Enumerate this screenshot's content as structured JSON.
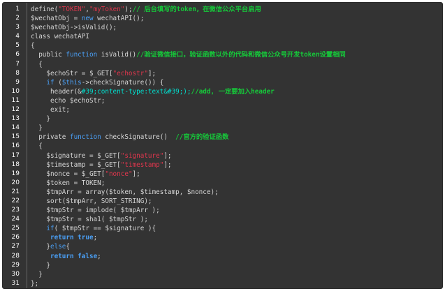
{
  "colors": {
    "background": "#333333",
    "text": "#d6d6d6",
    "keyword": "#4a9ff5",
    "string": "#e0364d",
    "comment": "#16c83a",
    "highlight": "#00e0d0",
    "line_number": "#ffffff"
  },
  "lines": [
    {
      "n": "1",
      "indent": "",
      "tokens": [
        {
          "t": "define(",
          "c": "tx"
        },
        {
          "t": "\"TOKEN\"",
          "c": "str"
        },
        {
          "t": ",",
          "c": "tx"
        },
        {
          "t": "\"myToken\"",
          "c": "str"
        },
        {
          "t": ");",
          "c": "tx"
        },
        {
          "t": "// 后台填写的token，在微信公众平台启用",
          "c": "cm"
        }
      ]
    },
    {
      "n": "2",
      "indent": "",
      "tokens": [
        {
          "t": "$wechatObj = ",
          "c": "tx"
        },
        {
          "t": "new",
          "c": "kw"
        },
        {
          "t": " wechatAPI();",
          "c": "tx"
        }
      ]
    },
    {
      "n": "3",
      "indent": "",
      "tokens": [
        {
          "t": "$wechatObj->isValid();",
          "c": "tx"
        }
      ]
    },
    {
      "n": "4",
      "indent": "",
      "tokens": [
        {
          "t": "class wechatAPI",
          "c": "tx"
        }
      ]
    },
    {
      "n": "5",
      "indent": "",
      "tokens": [
        {
          "t": "{",
          "c": "tx"
        }
      ]
    },
    {
      "n": "6",
      "indent": "  ",
      "tokens": [
        {
          "t": "public ",
          "c": "tx"
        },
        {
          "t": "function",
          "c": "kw"
        },
        {
          "t": " isValid()",
          "c": "tx"
        },
        {
          "t": "//验证微信接口，验证函数以外的代码和微信公众号开发token设置相同",
          "c": "cm"
        }
      ]
    },
    {
      "n": "7",
      "indent": "  ",
      "tokens": [
        {
          "t": "{",
          "c": "tx"
        }
      ]
    },
    {
      "n": "8",
      "indent": "    ",
      "tokens": [
        {
          "t": "$echoStr = $_GET[",
          "c": "tx"
        },
        {
          "t": "\"echostr\"",
          "c": "str"
        },
        {
          "t": "];",
          "c": "tx"
        }
      ]
    },
    {
      "n": "9",
      "indent": "    ",
      "tokens": [
        {
          "t": "if",
          "c": "kw"
        },
        {
          "t": " (",
          "c": "tx"
        },
        {
          "t": "$this",
          "c": "kw"
        },
        {
          "t": "->checkSignature()) {",
          "c": "tx"
        }
      ]
    },
    {
      "n": "10",
      "indent": "     ",
      "tokens": [
        {
          "t": "header(&",
          "c": "tx"
        },
        {
          "t": "#39;content-type:text&#39;);",
          "c": "hl"
        },
        {
          "t": "//add, 一定要加入header",
          "c": "cm"
        }
      ]
    },
    {
      "n": "11",
      "indent": "     ",
      "tokens": [
        {
          "t": "echo $echoStr;",
          "c": "tx"
        }
      ]
    },
    {
      "n": "12",
      "indent": "     ",
      "tokens": [
        {
          "t": "exit;",
          "c": "tx"
        }
      ]
    },
    {
      "n": "13",
      "indent": "    ",
      "tokens": [
        {
          "t": "}",
          "c": "tx"
        }
      ]
    },
    {
      "n": "14",
      "indent": "  ",
      "tokens": [
        {
          "t": "}",
          "c": "tx"
        }
      ]
    },
    {
      "n": "15",
      "indent": "  ",
      "tokens": [
        {
          "t": "private ",
          "c": "tx"
        },
        {
          "t": "function",
          "c": "kw"
        },
        {
          "t": " checkSignature()  ",
          "c": "tx"
        },
        {
          "t": "//官方的验证函数",
          "c": "cm"
        }
      ]
    },
    {
      "n": "16",
      "indent": "  ",
      "tokens": [
        {
          "t": "{",
          "c": "tx"
        }
      ]
    },
    {
      "n": "17",
      "indent": "    ",
      "tokens": [
        {
          "t": "$signature = $_GET[",
          "c": "tx"
        },
        {
          "t": "\"signature\"",
          "c": "str"
        },
        {
          "t": "];",
          "c": "tx"
        }
      ]
    },
    {
      "n": "18",
      "indent": "    ",
      "tokens": [
        {
          "t": "$timestamp = $_GET[",
          "c": "tx"
        },
        {
          "t": "\"timestamp\"",
          "c": "str"
        },
        {
          "t": "];",
          "c": "tx"
        }
      ]
    },
    {
      "n": "19",
      "indent": "    ",
      "tokens": [
        {
          "t": "$nonce = $_GET[",
          "c": "tx"
        },
        {
          "t": "\"nonce\"",
          "c": "str"
        },
        {
          "t": "];",
          "c": "tx"
        }
      ]
    },
    {
      "n": "20",
      "indent": "    ",
      "tokens": [
        {
          "t": "$token = TOKEN;",
          "c": "tx"
        }
      ]
    },
    {
      "n": "21",
      "indent": "    ",
      "tokens": [
        {
          "t": "$tmpArr = array($token, $timestamp, $nonce);",
          "c": "tx"
        }
      ]
    },
    {
      "n": "22",
      "indent": "    ",
      "tokens": [
        {
          "t": "sort($tmpArr, SORT_STRING);",
          "c": "tx"
        }
      ]
    },
    {
      "n": "23",
      "indent": "    ",
      "tokens": [
        {
          "t": "$tmpStr = implode( $tmpArr );",
          "c": "tx"
        }
      ]
    },
    {
      "n": "24",
      "indent": "    ",
      "tokens": [
        {
          "t": "$tmpStr = sha1( $tmpStr );",
          "c": "tx"
        }
      ]
    },
    {
      "n": "25",
      "indent": "    ",
      "tokens": [
        {
          "t": "if",
          "c": "kw"
        },
        {
          "t": "( $tmpStr == $signature ){",
          "c": "tx"
        }
      ]
    },
    {
      "n": "26",
      "indent": "     ",
      "tokens": [
        {
          "t": "return true",
          "c": "kw bold"
        },
        {
          "t": ";",
          "c": "tx"
        }
      ]
    },
    {
      "n": "27",
      "indent": "    ",
      "tokens": [
        {
          "t": "}",
          "c": "tx"
        },
        {
          "t": "else",
          "c": "kw"
        },
        {
          "t": "{",
          "c": "tx"
        }
      ]
    },
    {
      "n": "28",
      "indent": "     ",
      "tokens": [
        {
          "t": "return false",
          "c": "kw bold"
        },
        {
          "t": ";",
          "c": "tx"
        }
      ]
    },
    {
      "n": "29",
      "indent": "    ",
      "tokens": [
        {
          "t": "}",
          "c": "tx"
        }
      ]
    },
    {
      "n": "30",
      "indent": "  ",
      "tokens": [
        {
          "t": "}",
          "c": "tx"
        }
      ]
    },
    {
      "n": "31",
      "indent": "",
      "tokens": [
        {
          "t": "};",
          "c": "tx"
        }
      ]
    }
  ]
}
